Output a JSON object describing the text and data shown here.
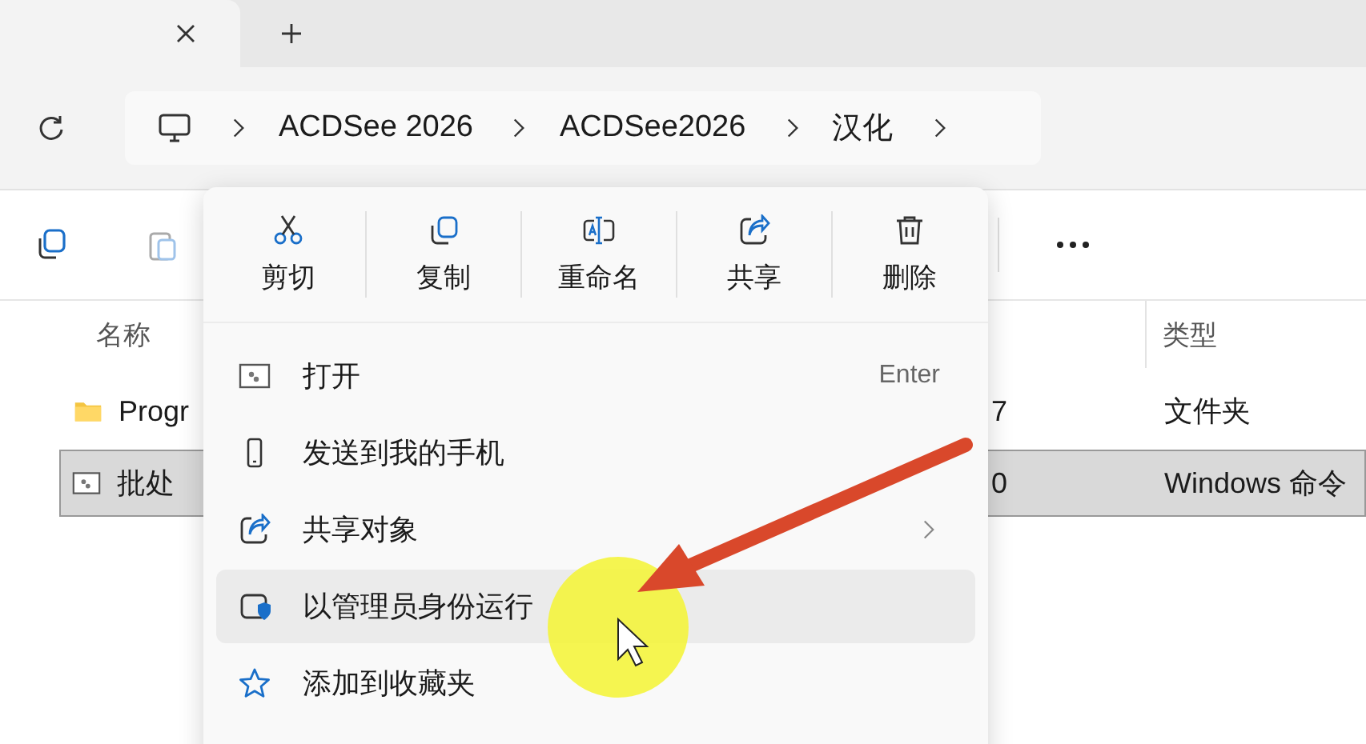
{
  "breadcrumb": [
    "ACDSee 2026",
    "ACDSee2026",
    "汉化"
  ],
  "columns": [
    {
      "label": "名称"
    },
    {
      "label": "类型"
    }
  ],
  "rows": [
    {
      "name": "Progr",
      "date": "7",
      "type": "文件夹",
      "selected": false
    },
    {
      "name": "批处",
      "date": "0",
      "type": "Windows 命令",
      "selected": true
    }
  ],
  "context_menu": {
    "quick_actions": [
      {
        "label": "剪切"
      },
      {
        "label": "复制"
      },
      {
        "label": "重命名"
      },
      {
        "label": "共享"
      },
      {
        "label": "删除"
      }
    ],
    "items": [
      {
        "label": "打开",
        "shortcut": "Enter",
        "has_submenu": false,
        "hovered": false
      },
      {
        "label": "发送到我的手机",
        "has_submenu": false,
        "hovered": false
      },
      {
        "label": "共享对象",
        "has_submenu": true,
        "hovered": false
      },
      {
        "label": "以管理员身份运行",
        "has_submenu": false,
        "hovered": true
      },
      {
        "label": "添加到收藏夹",
        "has_submenu": false,
        "hovered": false
      }
    ]
  }
}
